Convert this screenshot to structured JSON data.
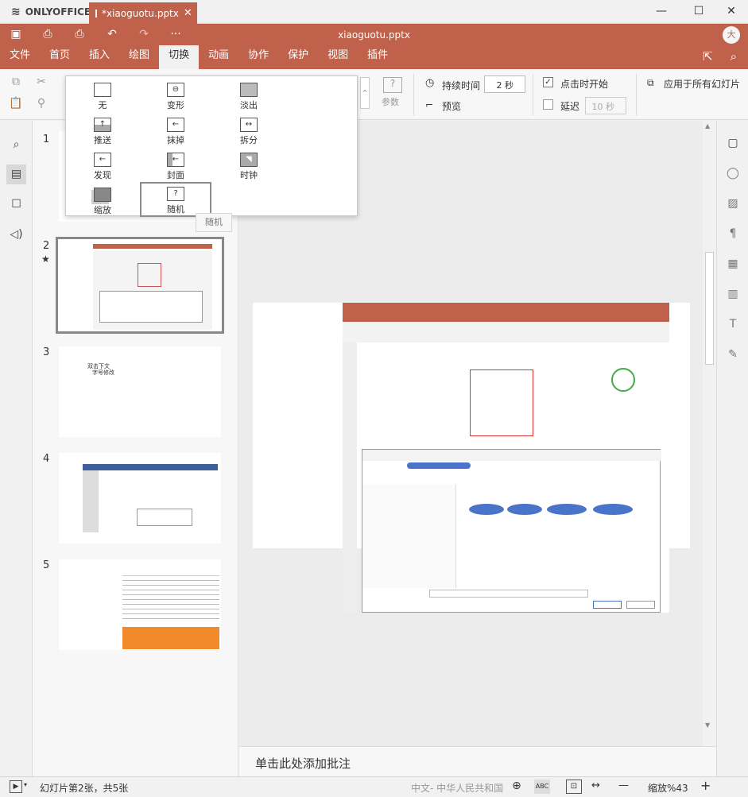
{
  "window": {
    "app_name": "ONLYOFFICE",
    "tab_title": "*xiaoguotu.pptx",
    "doc_title": "xiaoguotu.pptx",
    "avatar": "大",
    "close_tab": "✕",
    "minimize": "—",
    "maximize": "☐",
    "close": "✕"
  },
  "menu": {
    "items": [
      "文件",
      "首页",
      "插入",
      "绘图",
      "切换",
      "动画",
      "协作",
      "保护",
      "视图",
      "插件"
    ],
    "active": "切换"
  },
  "ribbon": {
    "params_label": "参数",
    "duration_label": "持续时间",
    "duration_value": "2 秒",
    "preview_label": "预览",
    "on_click_label": "点击时开始",
    "delay_label": "延迟",
    "delay_value": "10 秒",
    "apply_all_label": "应用于所有幻灯片"
  },
  "transitions": [
    {
      "label": "无",
      "icon": "none-transition-icon",
      "glyph": ""
    },
    {
      "label": "变形",
      "icon": "morph-transition-icon",
      "glyph": "⊖"
    },
    {
      "label": "淡出",
      "icon": "fade-transition-icon",
      "glyph": ""
    },
    {
      "label": "推送",
      "icon": "push-transition-icon",
      "glyph": "↑"
    },
    {
      "label": "抹掉",
      "icon": "wipe-transition-icon",
      "glyph": "←"
    },
    {
      "label": "拆分",
      "icon": "split-transition-icon",
      "glyph": "↔"
    },
    {
      "label": "发现",
      "icon": "uncover-transition-icon",
      "glyph": "←"
    },
    {
      "label": "封面",
      "icon": "cover-transition-icon",
      "glyph": "←"
    },
    {
      "label": "时钟",
      "icon": "clock-transition-icon",
      "glyph": "◥"
    },
    {
      "label": "缩放",
      "icon": "zoom-transition-icon",
      "glyph": ""
    },
    {
      "label": "随机",
      "icon": "random-transition-icon",
      "glyph": "?"
    }
  ],
  "tooltip": "随机",
  "slides": [
    {
      "num": "1"
    },
    {
      "num": "2"
    },
    {
      "num": "3",
      "text1": "双击下文",
      "text2": "字号修改"
    },
    {
      "num": "4"
    },
    {
      "num": "5"
    }
  ],
  "notes_placeholder": "单击此处添加批注",
  "status": {
    "slide_info": "幻灯片第2张，共5张",
    "language": "中文- 中华人民共和国",
    "zoom": "缩放%43",
    "zoom_minus": "—",
    "zoom_plus": "+"
  },
  "colors": {
    "accent": "#c0614b"
  }
}
